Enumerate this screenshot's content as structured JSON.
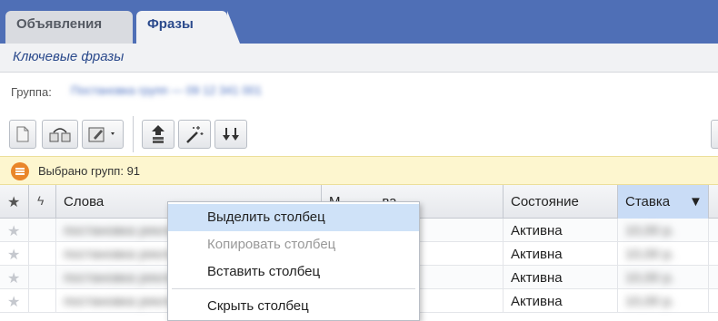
{
  "tabs": [
    {
      "label": "Объявления",
      "active": false
    },
    {
      "label": "Фразы",
      "active": true
    }
  ],
  "subheader": {
    "title": "Ключевые фразы"
  },
  "group": {
    "label": "Группа:",
    "value": "Постановка групп — 09 12 341 001"
  },
  "toolbar": {
    "buttons": [
      "new-icon",
      "copy-groups-icon",
      "edit-icon",
      "move-up-icon",
      "magic-wand-icon",
      "move-down-icon"
    ]
  },
  "notice": {
    "text": "Выбрано групп: 91",
    "icon": "list-icon",
    "color": "#e9862a"
  },
  "table": {
    "columns": [
      "Слова",
      "М...........ва",
      "Состояние",
      "Ставка"
    ],
    "sort_indicator": "▼",
    "rows": [
      {
        "words": "постановка рекламы",
        "status": "Активна",
        "bid": "10,00 р."
      },
      {
        "words": "постановка рекламы",
        "status": "Активна",
        "bid": "10,00 р."
      },
      {
        "words": "постановка рекламы",
        "status": "Активна",
        "bid": "10,00 р."
      },
      {
        "words": "постановка рекламы",
        "status": "Активна",
        "bid": "10,00 р."
      }
    ]
  },
  "context_menu": {
    "items": [
      {
        "label": "Выделить столбец",
        "state": "highlighted"
      },
      {
        "label": "Копировать столбец",
        "state": "disabled"
      },
      {
        "label": "Вставить столбец",
        "state": "normal"
      },
      {
        "label": "Скрыть столбец",
        "state": "normal"
      }
    ]
  },
  "colors": {
    "tabbar": "#4f6fb6",
    "accent": "#2b4a8c",
    "highlight": "#cfe2f8"
  }
}
